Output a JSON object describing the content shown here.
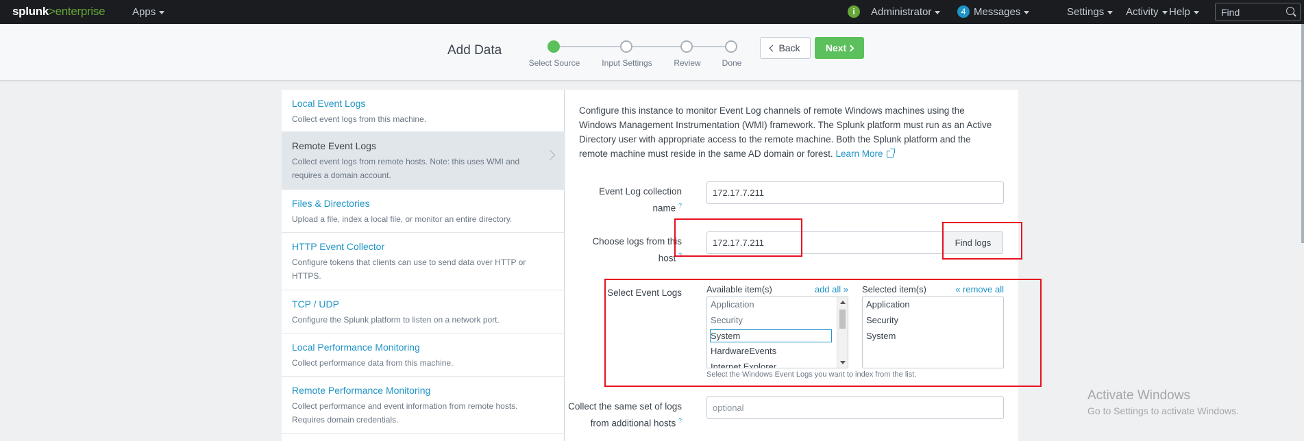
{
  "topbar": {
    "logo_part1": "splunk",
    "logo_part2": ">enterprise",
    "apps": "Apps",
    "info_icon": "i",
    "administrator": "Administrator",
    "messages_count": "4",
    "messages": "Messages",
    "settings": "Settings",
    "activity": "Activity",
    "help": "Help",
    "find_placeholder": "Find"
  },
  "wizard": {
    "title": "Add Data",
    "steps": [
      {
        "label": "Select Source"
      },
      {
        "label": "Input Settings"
      },
      {
        "label": "Review"
      },
      {
        "label": "Done"
      }
    ],
    "back": "Back",
    "next": "Next"
  },
  "sidebar": {
    "items": [
      {
        "title": "Local Event Logs",
        "desc": "Collect event logs from this machine."
      },
      {
        "title": "Remote Event Logs",
        "desc": "Collect event logs from remote hosts. Note: this uses WMI and requires a domain account."
      },
      {
        "title": "Files & Directories",
        "desc": "Upload a file, index a local file, or monitor an entire directory."
      },
      {
        "title": "HTTP Event Collector",
        "desc": "Configure tokens that clients can use to send data over HTTP or HTTPS."
      },
      {
        "title": "TCP / UDP",
        "desc": "Configure the Splunk platform to listen on a network port."
      },
      {
        "title": "Local Performance Monitoring",
        "desc": "Collect performance data from this machine."
      },
      {
        "title": "Remote Performance Monitoring",
        "desc": "Collect performance and event information from remote hosts. Requires domain credentials."
      }
    ]
  },
  "main": {
    "intro": "Configure this instance to monitor Event Log channels of remote Windows machines using the Windows Management Instrumentation (WMI) framework. The Splunk platform must run as an Active Directory user with appropriate access to the remote machine. Both the Splunk platform and the remote machine must reside in the same AD domain or forest.",
    "learn_more": "Learn More",
    "collection_name_label1": "Event Log collection",
    "collection_name_label2": "name",
    "collection_name_value": "172.17.7.211",
    "host_label1": "Choose logs from this",
    "host_label2": "host",
    "host_value": "172.17.7.211",
    "find_logs": "Find logs",
    "select_label": "Select Event Logs",
    "available_header": "Available item(s)",
    "add_all": "add all »",
    "selected_header": "Selected item(s)",
    "remove_all": "« remove all",
    "available_items": [
      "Application",
      "Security",
      "System",
      "HardwareEvents",
      "Internet Explorer"
    ],
    "selected_items": [
      "Application",
      "Security",
      "System"
    ],
    "select_help": "Select the Windows Event Logs you want to index from the list.",
    "additional_label1": "Collect the same set of logs",
    "additional_label2": "from additional hosts",
    "additional_placeholder": "optional",
    "help_mark": "?"
  },
  "watermark": {
    "line1": "Activate Windows",
    "line2": "Go to Settings to activate Windows."
  }
}
